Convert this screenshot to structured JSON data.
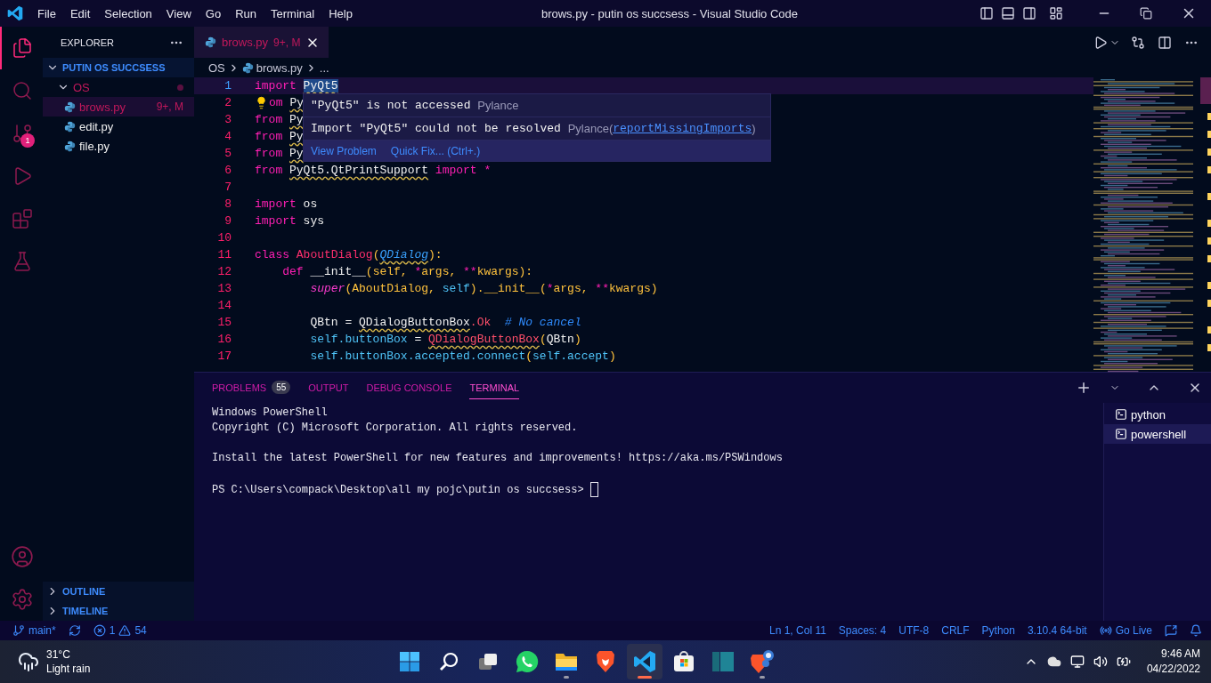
{
  "title_bar": {
    "menu": [
      "File",
      "Edit",
      "Selection",
      "View",
      "Go",
      "Run",
      "Terminal",
      "Help"
    ],
    "title": "brows.py - putin os succsess - Visual Studio Code"
  },
  "activity_bar": {
    "items": [
      {
        "kind": "explorer",
        "selected": true
      },
      {
        "kind": "search",
        "selected": false
      },
      {
        "kind": "scm",
        "selected": false,
        "badge": "1"
      },
      {
        "kind": "debug",
        "selected": false
      },
      {
        "kind": "extensions",
        "selected": false
      },
      {
        "kind": "testing",
        "selected": false
      }
    ],
    "bottom": [
      {
        "kind": "account"
      },
      {
        "kind": "settings"
      }
    ]
  },
  "sidebar": {
    "title": "EXPLORER",
    "folder": {
      "label": "PUTIN OS SUCCSESS",
      "expanded": true,
      "children": [
        {
          "label": "OS",
          "expanded": true,
          "modified": true,
          "children": [
            {
              "label": "brows.py",
              "status": "9+, M",
              "selected": true
            },
            {
              "label": "edit.py",
              "selected": false
            },
            {
              "label": "file.py",
              "selected": false
            }
          ]
        }
      ]
    },
    "sections": [
      {
        "label": "OUTLINE",
        "expanded": false
      },
      {
        "label": "TIMELINE",
        "expanded": false
      }
    ]
  },
  "editor": {
    "tabs": [
      {
        "label": "brows.py",
        "status": "9+, M",
        "selected": true
      }
    ],
    "breadcrumb": [
      "OS",
      "brows.py",
      "..."
    ],
    "lines": [
      {
        "n": "1",
        "current": true,
        "tokens": [
          {
            "t": "import ",
            "kind": "keyword"
          },
          {
            "t": "PyQt5",
            "kind": "plain",
            "squiggle": true,
            "highlight": true
          }
        ]
      },
      {
        "n": "2",
        "current": false,
        "lightbulb": true,
        "tokens": [
          {
            "t": "om ",
            "kind": "keyword"
          },
          {
            "t": "Py",
            "kind": "plain",
            "squiggle": true
          }
        ]
      },
      {
        "n": "3",
        "current": false,
        "tokens": [
          {
            "t": "from ",
            "kind": "keyword"
          },
          {
            "t": "Py",
            "kind": "plain",
            "squiggle": true
          }
        ]
      },
      {
        "n": "4",
        "current": false,
        "tokens": [
          {
            "t": "from ",
            "kind": "keyword"
          },
          {
            "t": "Py",
            "kind": "plain",
            "squiggle": true
          }
        ]
      },
      {
        "n": "5",
        "current": false,
        "tokens": [
          {
            "t": "from ",
            "kind": "keyword"
          },
          {
            "t": "Py",
            "kind": "plain",
            "squiggle": true
          }
        ]
      },
      {
        "n": "6",
        "current": false,
        "tokens": [
          {
            "t": "from ",
            "kind": "keyword"
          },
          {
            "t": "PyQt5.QtPrintSupport",
            "kind": "plain",
            "squiggle": true
          },
          {
            "t": " import *",
            "kind": "keyword"
          }
        ]
      },
      {
        "n": "7",
        "current": false
      },
      {
        "n": "8",
        "current": false,
        "tokens": [
          {
            "t": "import ",
            "kind": "keyword"
          },
          {
            "t": "os",
            "kind": "plain"
          }
        ]
      },
      {
        "n": "9",
        "current": false,
        "tokens": [
          {
            "t": "import ",
            "kind": "keyword"
          },
          {
            "t": "sys",
            "kind": "plain"
          }
        ]
      },
      {
        "n": "10",
        "current": false
      },
      {
        "n": "11",
        "current": false,
        "tokens": [
          {
            "t": "class ",
            "kind": "keyword"
          },
          {
            "t": "AboutDialog",
            "kind": "classname"
          },
          {
            "t": "(",
            "kind": "punct"
          },
          {
            "t": "QDialog",
            "kind": "type",
            "squiggle": true
          },
          {
            "t": "):",
            "kind": "punct"
          }
        ]
      },
      {
        "n": "12",
        "current": false,
        "tokens": [
          {
            "t": "    def",
            "kind": "keyword"
          },
          {
            "t": " __init__",
            "kind": "plain"
          },
          {
            "t": "(self, ",
            "kind": "param"
          },
          {
            "t": "*",
            "kind": "keyword"
          },
          {
            "t": "args, ",
            "kind": "param"
          },
          {
            "t": "**",
            "kind": "keyword"
          },
          {
            "t": "kwargs):",
            "kind": "param"
          }
        ]
      },
      {
        "n": "13",
        "current": false,
        "tokens": [
          {
            "t": "        super",
            "kind": "builtin"
          },
          {
            "t": "(AboutDialog, ",
            "kind": "param"
          },
          {
            "t": "self",
            "kind": "self"
          },
          {
            "t": ").",
            "kind": "punct"
          },
          {
            "t": "__init__",
            "kind": "param"
          },
          {
            "t": "(",
            "kind": "punct"
          },
          {
            "t": "*",
            "kind": "keyword"
          },
          {
            "t": "args, ",
            "kind": "param"
          },
          {
            "t": "**",
            "kind": "keyword"
          },
          {
            "t": "kwargs)",
            "kind": "param"
          }
        ]
      },
      {
        "n": "14",
        "current": false
      },
      {
        "n": "15",
        "current": false,
        "tokens": [
          {
            "t": "        QBtn = ",
            "kind": "plain"
          },
          {
            "t": "QDialogButtonBox",
            "kind": "plain",
            "squiggle": true
          },
          {
            "t": ".Ok",
            "kind": "attr"
          },
          {
            "t": "  # No cancel",
            "kind": "comment"
          }
        ]
      },
      {
        "n": "16",
        "current": false,
        "tokens": [
          {
            "t": "        self.buttonBox",
            "kind": "self"
          },
          {
            "t": " = ",
            "kind": "plain"
          },
          {
            "t": "QDialogButtonBox",
            "kind": "attr",
            "squiggle": true
          },
          {
            "t": "(",
            "kind": "punct"
          },
          {
            "t": "QBtn",
            "kind": "plain"
          },
          {
            "t": ")",
            "kind": "punct"
          }
        ]
      },
      {
        "n": "17",
        "current": false,
        "tokens": [
          {
            "t": "        self.buttonBox.accepted.connect",
            "kind": "self"
          },
          {
            "t": "(",
            "kind": "punct"
          },
          {
            "t": "self.accept",
            "kind": "self"
          },
          {
            "t": ")",
            "kind": "punct"
          }
        ]
      }
    ],
    "hover": {
      "messages": [
        {
          "text": "\"PyQt5\" is not accessed",
          "source": "Pylance"
        },
        {
          "text": "Import \"PyQt5\" could not be resolved",
          "source": "Pylance(",
          "link": "reportMissingImports",
          "suffix": ")"
        }
      ],
      "actions": [
        "View Problem",
        "Quick Fix... (Ctrl+.)"
      ]
    }
  },
  "panel": {
    "tabs": [
      {
        "label": "PROBLEMS",
        "badge": "55",
        "selected": false
      },
      {
        "label": "OUTPUT",
        "selected": false
      },
      {
        "label": "DEBUG CONSOLE",
        "selected": false
      },
      {
        "label": "TERMINAL",
        "selected": true
      }
    ],
    "terminal_paragraphs": [
      [
        "Windows PowerShell",
        "Copyright (C) Microsoft Corporation. All rights reserved."
      ],
      [
        "Install the latest PowerShell for new features and improvements! https://aka.ms/PSWindows"
      ]
    ],
    "prompt": "PS C:\\Users\\compack\\Desktop\\all my pojc\\putin os succsess>",
    "terminals": [
      {
        "label": "python",
        "selected": false
      },
      {
        "label": "powershell",
        "selected": true
      }
    ]
  },
  "status_bar": {
    "branch": "main*",
    "errors": "1",
    "warnings": "54",
    "right": [
      "Ln 1, Col 11",
      "Spaces: 4",
      "UTF-8",
      "CRLF",
      "Python",
      "3.10.4 64-bit"
    ],
    "go_live": "Go Live"
  },
  "taskbar": {
    "weather": {
      "temp": "31°C",
      "desc": "Light rain"
    },
    "apps": [
      {
        "kind": "start",
        "running": false,
        "selected": false
      },
      {
        "kind": "search",
        "running": false,
        "selected": false
      },
      {
        "kind": "taskview",
        "running": false,
        "selected": false
      },
      {
        "kind": "whatsapp",
        "running": false,
        "selected": false
      },
      {
        "kind": "explorer",
        "running": true,
        "selected": false
      },
      {
        "kind": "brave",
        "running": false,
        "selected": false
      },
      {
        "kind": "vscode",
        "running": true,
        "selected": true
      },
      {
        "kind": "store",
        "running": false,
        "selected": false
      },
      {
        "kind": "panel",
        "running": false,
        "selected": false
      },
      {
        "kind": "brave_ext",
        "running": true,
        "selected": false
      }
    ],
    "clock": {
      "time": "9:46 AM",
      "date": "04/22/2022"
    }
  }
}
